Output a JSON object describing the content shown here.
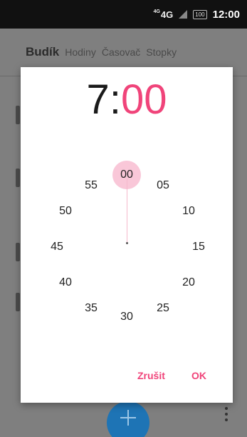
{
  "status_bar": {
    "network": "4G",
    "network_sup": "4G",
    "battery": "100",
    "time": "12:00"
  },
  "tabs": [
    {
      "label": "Budík",
      "active": true
    },
    {
      "label": "Hodiny",
      "active": false
    },
    {
      "label": "Časovač",
      "active": false
    },
    {
      "label": "Stopky",
      "active": false
    }
  ],
  "dialog": {
    "time": {
      "hour": "7",
      "separator": ":",
      "minute": "00"
    },
    "minutes": [
      "00",
      "05",
      "10",
      "15",
      "20",
      "25",
      "30",
      "35",
      "40",
      "45",
      "50",
      "55"
    ],
    "selected_minute": "00",
    "cancel_label": "Zrušit",
    "ok_label": "OK"
  },
  "colors": {
    "accent": "#f0447a",
    "selector": "#f9c7d8",
    "fab": "#1e74b5"
  }
}
